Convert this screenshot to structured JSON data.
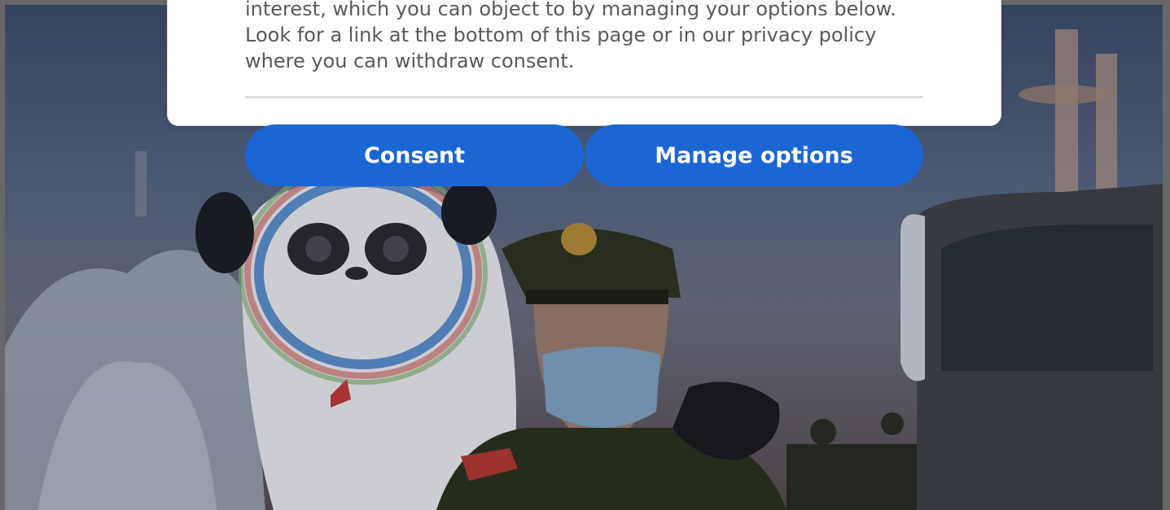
{
  "consent_dialog": {
    "body_text": "interest, which you can object to by managing your options below. Look for a link at the bottom of this page or in our privacy policy where you can withdraw consent.",
    "consent_label": "Consent",
    "manage_label": "Manage options"
  },
  "colors": {
    "button_bg": "#1b66d3",
    "button_text": "#ffffff",
    "body_text": "#595959"
  }
}
